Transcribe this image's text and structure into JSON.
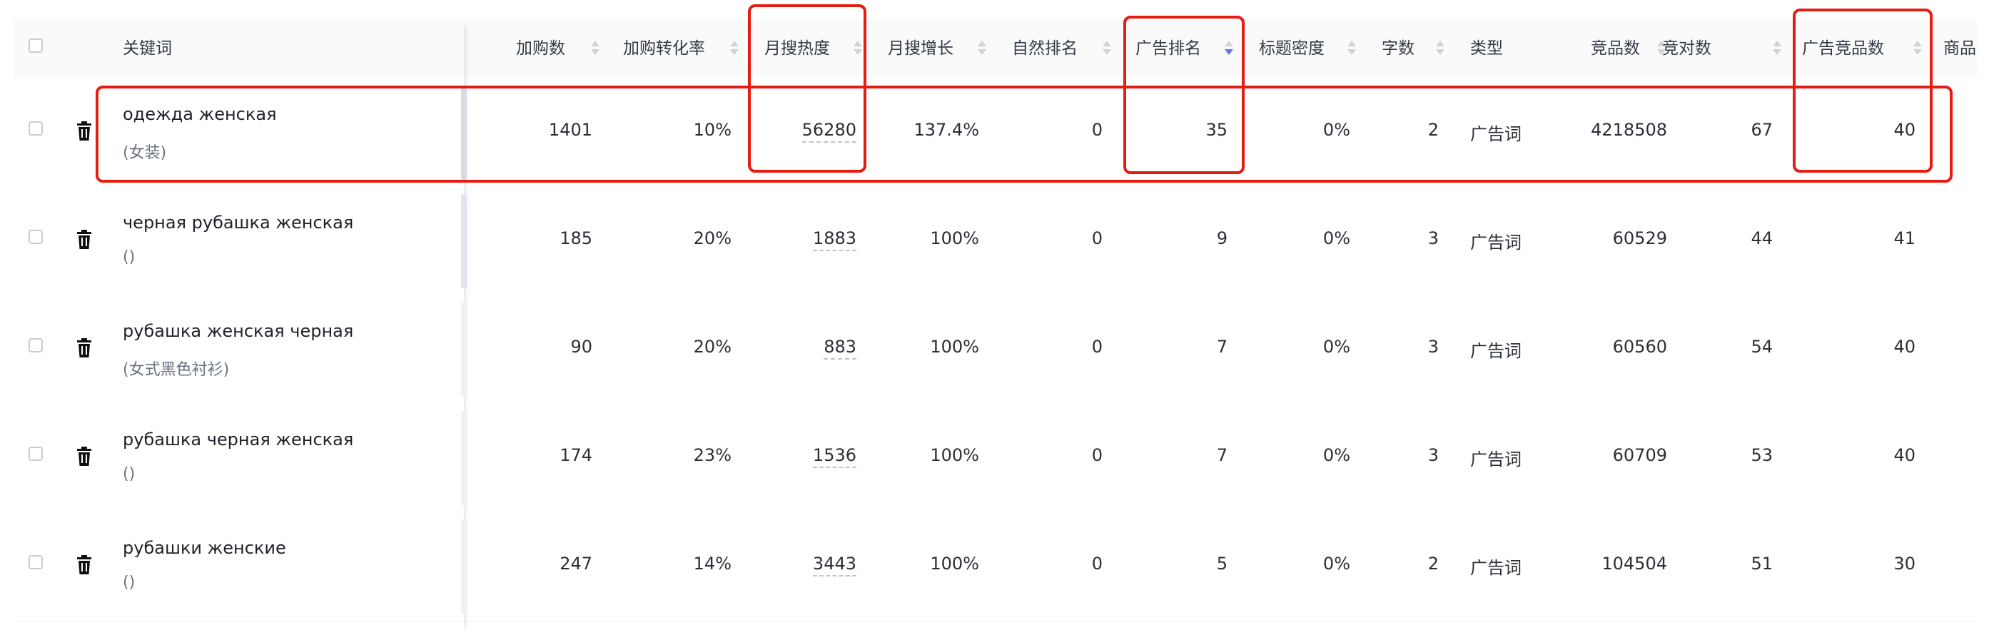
{
  "table": {
    "headers": {
      "keyword": "关键词",
      "add_to_cart": "加购数",
      "add_to_cart_rate": "加购转化率",
      "monthly_search_heat": "月搜热度",
      "monthly_search_growth": "月搜增长",
      "natural_rank": "自然排名",
      "ad_rank": "广告排名",
      "title_density": "标题密度",
      "word_count": "字数",
      "type": "类型",
      "competitors": "竞品数",
      "competitive_count": "竞对数",
      "ad_competitors": "广告竞品数",
      "product_truncated": "商品"
    },
    "rows": [
      {
        "keyword": "одежда женская",
        "translation": "(女装)",
        "add_to_cart": "1401",
        "add_to_cart_rate": "10%",
        "monthly_search_heat": "56280",
        "monthly_search_growth": "137.4%",
        "natural_rank": "0",
        "ad_rank": "35",
        "title_density": "0%",
        "word_count": "2",
        "type": "广告词",
        "competitors": "4218508",
        "competitive_count": "67",
        "ad_competitors": "40"
      },
      {
        "keyword": "черная рубашка женская",
        "translation": "()",
        "add_to_cart": "185",
        "add_to_cart_rate": "20%",
        "monthly_search_heat": "1883",
        "monthly_search_growth": "100%",
        "natural_rank": "0",
        "ad_rank": "9",
        "title_density": "0%",
        "word_count": "3",
        "type": "广告词",
        "competitors": "60529",
        "competitive_count": "44",
        "ad_competitors": "41"
      },
      {
        "keyword": "рубашка женская черная",
        "translation": "(女式黑色衬衫)",
        "add_to_cart": "90",
        "add_to_cart_rate": "20%",
        "monthly_search_heat": "883",
        "monthly_search_growth": "100%",
        "natural_rank": "0",
        "ad_rank": "7",
        "title_density": "0%",
        "word_count": "3",
        "type": "广告词",
        "competitors": "60560",
        "competitive_count": "54",
        "ad_competitors": "40"
      },
      {
        "keyword": "рубашка черная женская",
        "translation": "()",
        "add_to_cart": "174",
        "add_to_cart_rate": "23%",
        "monthly_search_heat": "1536",
        "monthly_search_growth": "100%",
        "natural_rank": "0",
        "ad_rank": "7",
        "title_density": "0%",
        "word_count": "3",
        "type": "广告词",
        "competitors": "60709",
        "competitive_count": "53",
        "ad_competitors": "40"
      },
      {
        "keyword": "рубашки женские",
        "translation": "()",
        "add_to_cart": "247",
        "add_to_cart_rate": "14%",
        "monthly_search_heat": "3443",
        "monthly_search_growth": "100%",
        "natural_rank": "0",
        "ad_rank": "5",
        "title_density": "0%",
        "word_count": "2",
        "type": "广告词",
        "competitors": "104504",
        "competitive_count": "51",
        "ad_competitors": "30"
      }
    ],
    "sort": {
      "active_column": "ad_rank",
      "direction": "descending"
    },
    "icons": {
      "row_action": "trash-icon",
      "sort": "sort-caret-icon"
    },
    "colors": {
      "annotation_red": "#e51c12",
      "sort_active": "#6a6ff3"
    }
  }
}
